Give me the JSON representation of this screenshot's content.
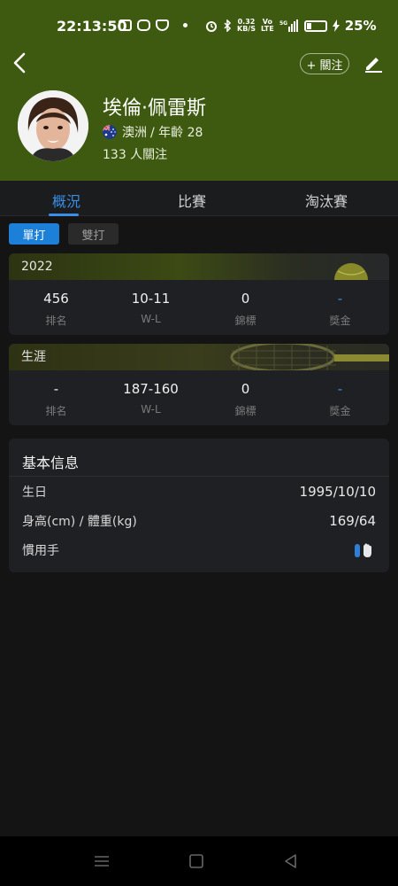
{
  "status_bar": {
    "time": "22:13:50",
    "speed": "0.32\nKB/S",
    "battery": "25%"
  },
  "header": {
    "follow_label": "+ 關注",
    "player_name": "埃倫·佩雷斯",
    "country": "澳洲",
    "age_text": "/ 年齡 28",
    "followers": "133 人關注"
  },
  "tabs": [
    {
      "label": "概況"
    },
    {
      "label": "比賽"
    },
    {
      "label": "淘汰賽"
    }
  ],
  "toggle": {
    "singles": "單打",
    "doubles": "雙打"
  },
  "cards": [
    {
      "title": "2022",
      "stats": [
        {
          "value": "456",
          "label": "排名"
        },
        {
          "value": "10-11",
          "label": "W-L"
        },
        {
          "value": "0",
          "label": "錦標"
        },
        {
          "value": "-",
          "label": "獎金"
        }
      ]
    },
    {
      "title": "生涯",
      "stats": [
        {
          "value": "-",
          "label": "排名"
        },
        {
          "value": "187-160",
          "label": "W-L"
        },
        {
          "value": "0",
          "label": "錦標"
        },
        {
          "value": "-",
          "label": "獎金"
        }
      ]
    }
  ],
  "basic_info": {
    "title": "基本信息",
    "rows": [
      {
        "label": "生日",
        "value": "1995/10/10"
      },
      {
        "label": "身高(cm) / 體重(kg)",
        "value": "169/64"
      },
      {
        "label": "慣用手",
        "value": ""
      }
    ]
  },
  "colors": {
    "header_green": "#3e5a10",
    "accent_blue": "#1c7fd8"
  }
}
